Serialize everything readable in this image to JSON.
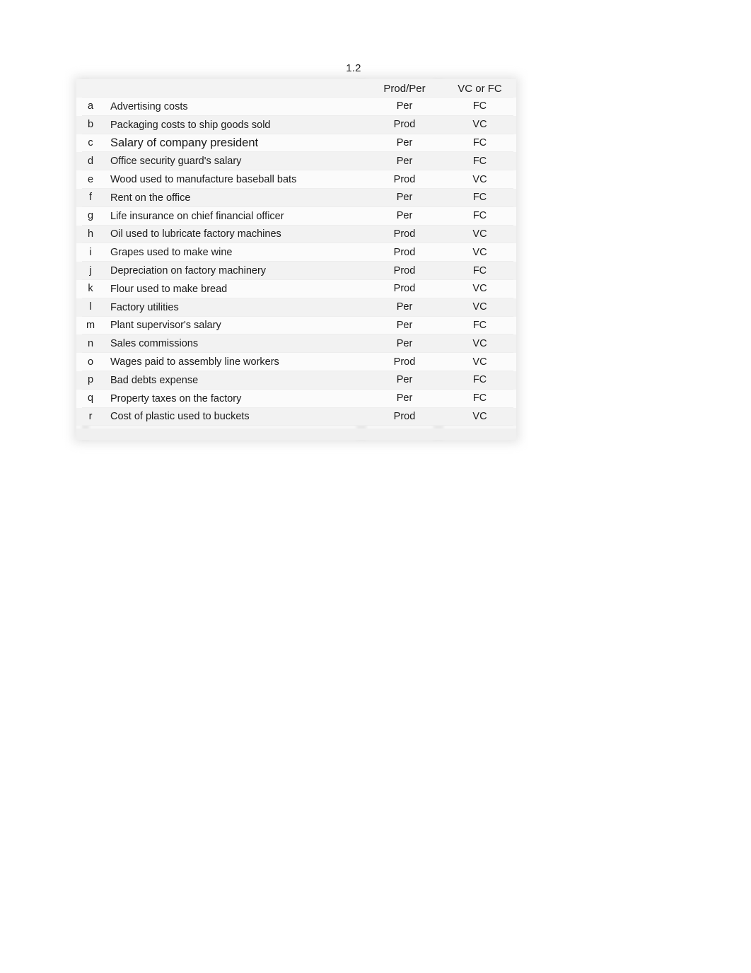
{
  "document": {
    "title": "1.2"
  },
  "table": {
    "columns": {
      "key": "",
      "description": "",
      "prod_per": "Prod/Per",
      "vc_or_fc": "VC or FC"
    },
    "rows": [
      {
        "key": "a",
        "description": "Advertising costs",
        "prod_per": "Per",
        "vc_or_fc": "FC"
      },
      {
        "key": "b",
        "description": "Packaging costs to ship goods sold",
        "prod_per": "Prod",
        "vc_or_fc": "VC"
      },
      {
        "key": "c",
        "description": "Salary of company president",
        "prod_per": "Per",
        "vc_or_fc": "FC"
      },
      {
        "key": "d",
        "description": "Office security guard's salary",
        "prod_per": "Per",
        "vc_or_fc": "FC"
      },
      {
        "key": "e",
        "description": "Wood used to manufacture baseball bats",
        "prod_per": "Prod",
        "vc_or_fc": "VC"
      },
      {
        "key": "f",
        "description": "Rent on the office",
        "prod_per": "Per",
        "vc_or_fc": "FC"
      },
      {
        "key": "g",
        "description": "Life insurance on chief financial officer",
        "prod_per": "Per",
        "vc_or_fc": "FC"
      },
      {
        "key": "h",
        "description": "Oil used to lubricate factory machines",
        "prod_per": "Prod",
        "vc_or_fc": "VC"
      },
      {
        "key": "i",
        "description": "Grapes used to make wine",
        "prod_per": "Prod",
        "vc_or_fc": "VC"
      },
      {
        "key": "j",
        "description": "Depreciation on factory machinery",
        "prod_per": "Prod",
        "vc_or_fc": "FC"
      },
      {
        "key": "k",
        "description": "Flour used to make bread",
        "prod_per": "Prod",
        "vc_or_fc": "VC"
      },
      {
        "key": "l",
        "description": "Factory utilities",
        "prod_per": "Per",
        "vc_or_fc": "VC"
      },
      {
        "key": "m",
        "description": "Plant supervisor's salary",
        "prod_per": "Per",
        "vc_or_fc": "FC"
      },
      {
        "key": "n",
        "description": "Sales commissions",
        "prod_per": "Per",
        "vc_or_fc": "VC"
      },
      {
        "key": "o",
        "description": "Wages paid to assembly line workers",
        "prod_per": "Prod",
        "vc_or_fc": "VC"
      },
      {
        "key": "p",
        "description": "Bad debts expense",
        "prod_per": "Per",
        "vc_or_fc": "FC"
      },
      {
        "key": "q",
        "description": "Property taxes on the factory",
        "prod_per": "Per",
        "vc_or_fc": "FC"
      },
      {
        "key": "r",
        "description": "Cost of plastic used to buckets",
        "prod_per": "Prod",
        "vc_or_fc": "VC"
      }
    ]
  }
}
